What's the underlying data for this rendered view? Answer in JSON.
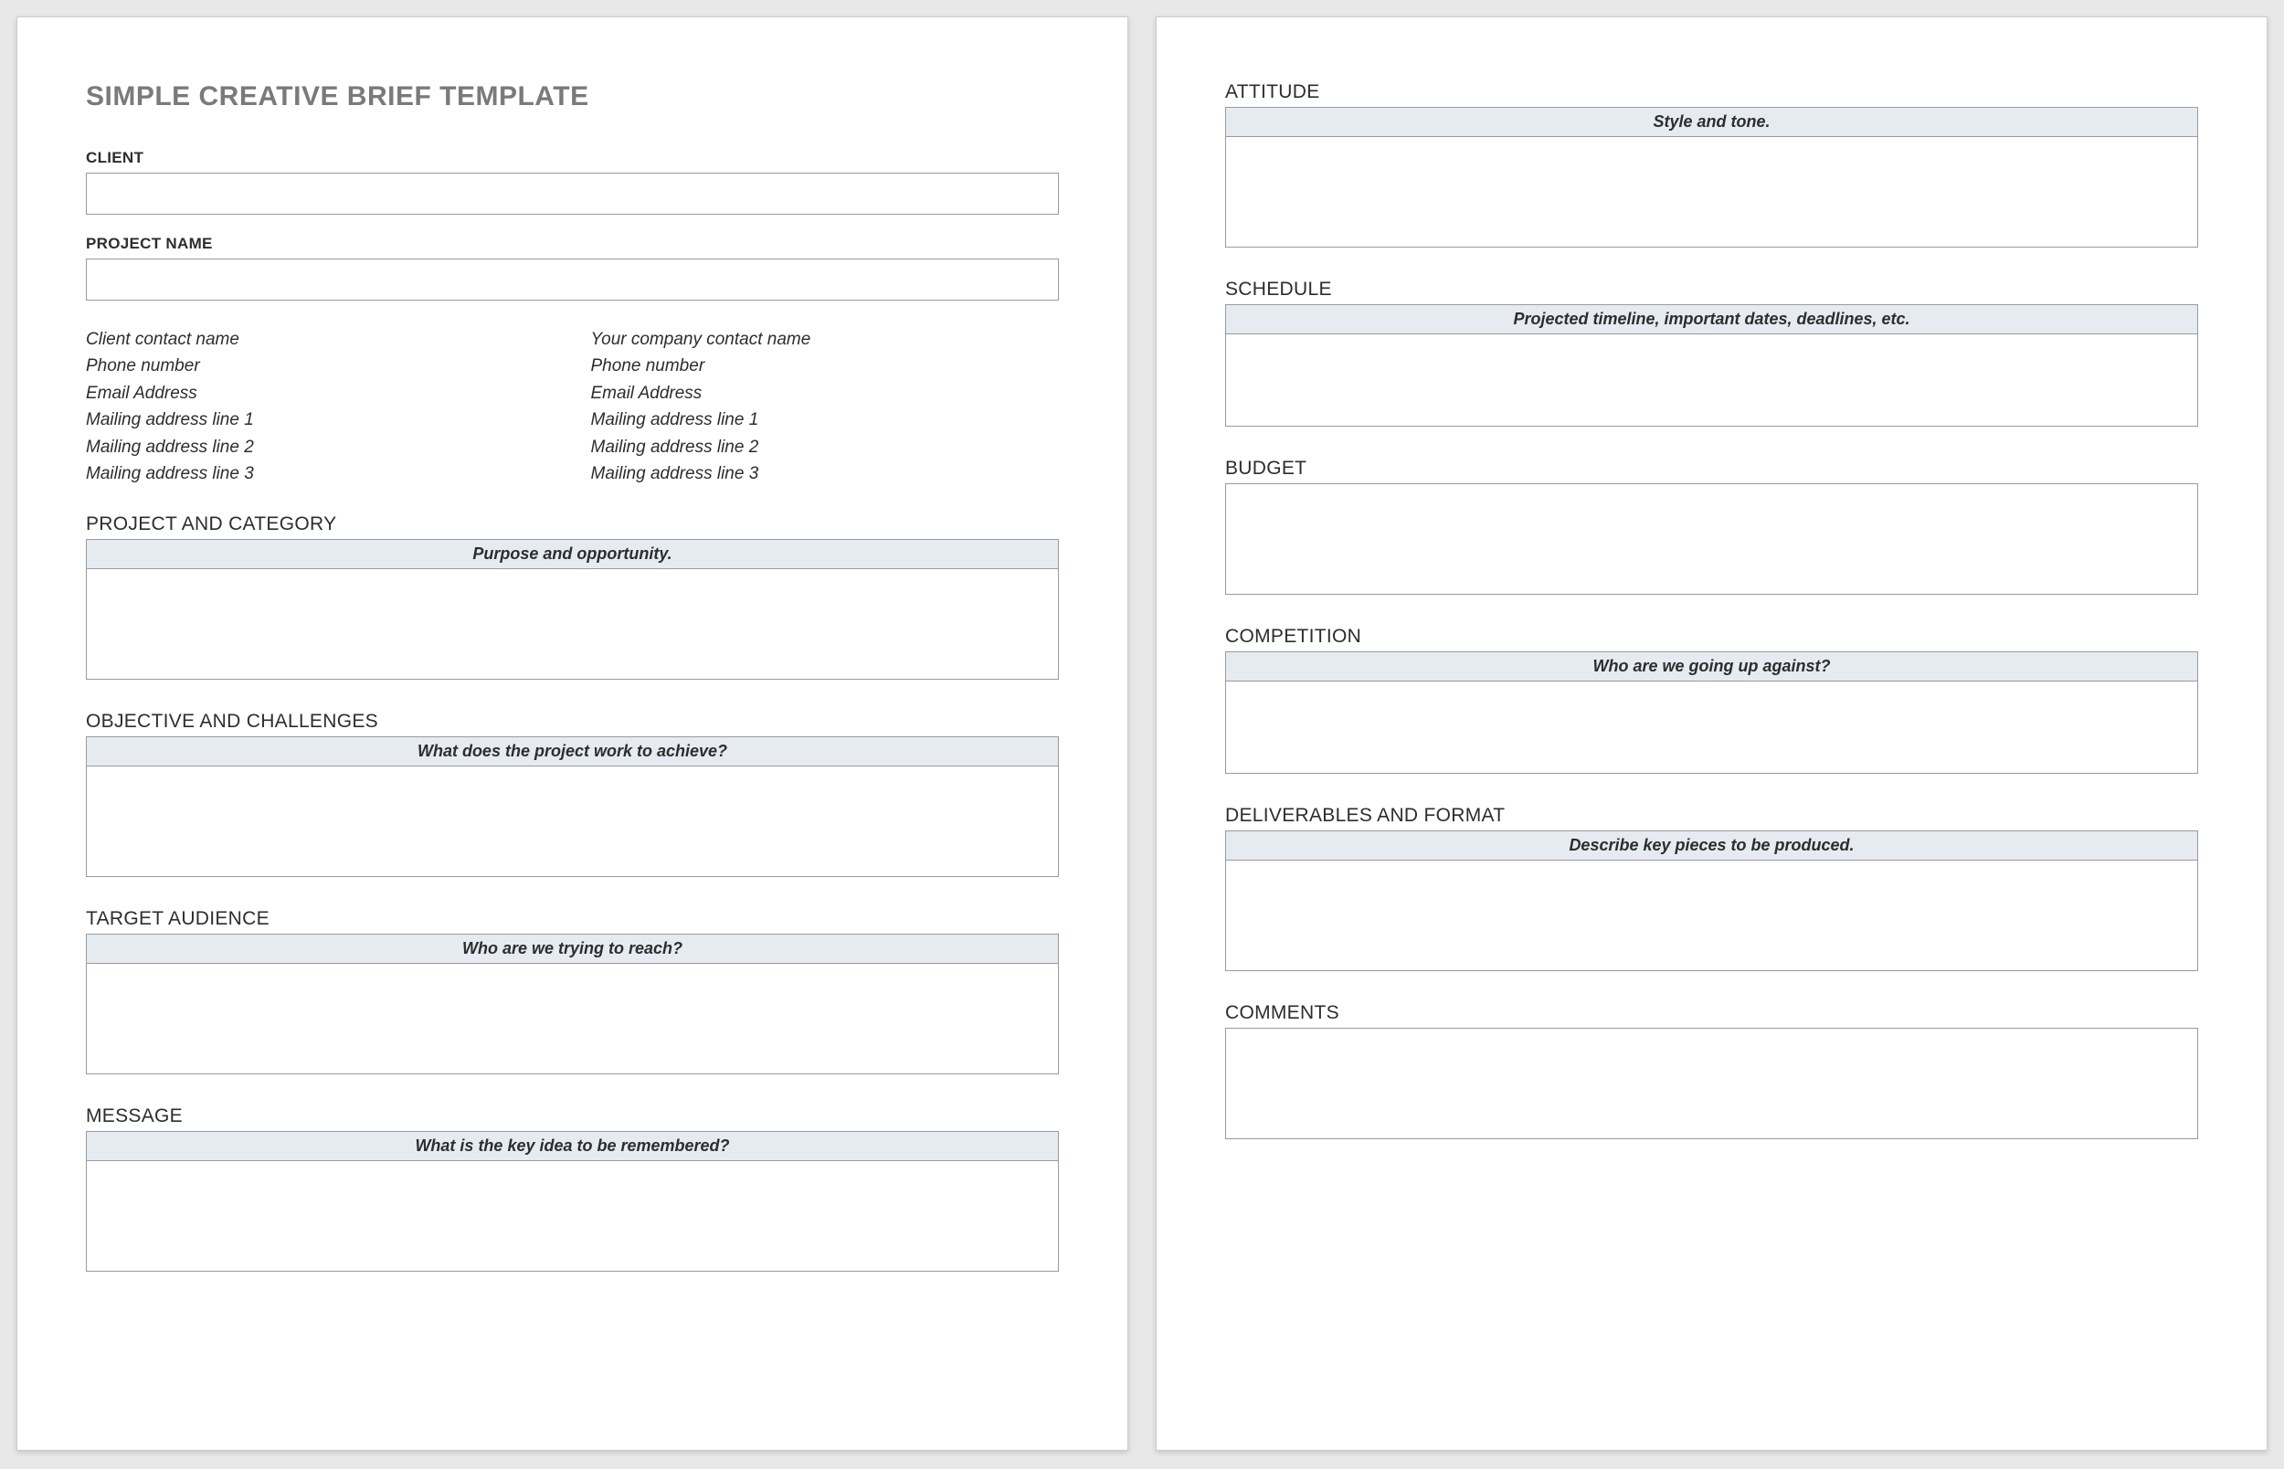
{
  "title": "SIMPLE CREATIVE BRIEF TEMPLATE",
  "fields": {
    "client_label": "CLIENT",
    "client_value": "",
    "project_name_label": "PROJECT NAME",
    "project_name_value": ""
  },
  "client_contact": [
    "Client contact name",
    "Phone number",
    "Email Address",
    "Mailing address line 1",
    "Mailing address line 2",
    "Mailing address line 3"
  ],
  "company_contact": [
    "Your company contact name",
    "Phone number",
    "Email Address",
    "Mailing address line 1",
    "Mailing address line 2",
    "Mailing address line 3"
  ],
  "sections": {
    "project_category": {
      "label": "PROJECT AND CATEGORY",
      "prompt": "Purpose and opportunity.",
      "value": ""
    },
    "objective": {
      "label": "OBJECTIVE AND CHALLENGES",
      "prompt": "What does the project work to achieve?",
      "value": ""
    },
    "audience": {
      "label": "TARGET AUDIENCE",
      "prompt": "Who are we trying to reach?",
      "value": ""
    },
    "message": {
      "label": "MESSAGE",
      "prompt": "What is the key idea to be remembered?",
      "value": ""
    },
    "attitude": {
      "label": "ATTITUDE",
      "prompt": "Style and tone.",
      "value": ""
    },
    "schedule": {
      "label": "SCHEDULE",
      "prompt": "Projected timeline, important dates, deadlines, etc.",
      "value": ""
    },
    "budget": {
      "label": "BUDGET",
      "prompt": "",
      "value": ""
    },
    "competition": {
      "label": "COMPETITION",
      "prompt": "Who are we going up against?",
      "value": ""
    },
    "deliverables": {
      "label": "DELIVERABLES AND FORMAT",
      "prompt": "Describe key pieces to be produced.",
      "value": ""
    },
    "comments": {
      "label": "COMMENTS",
      "prompt": "",
      "value": ""
    }
  }
}
